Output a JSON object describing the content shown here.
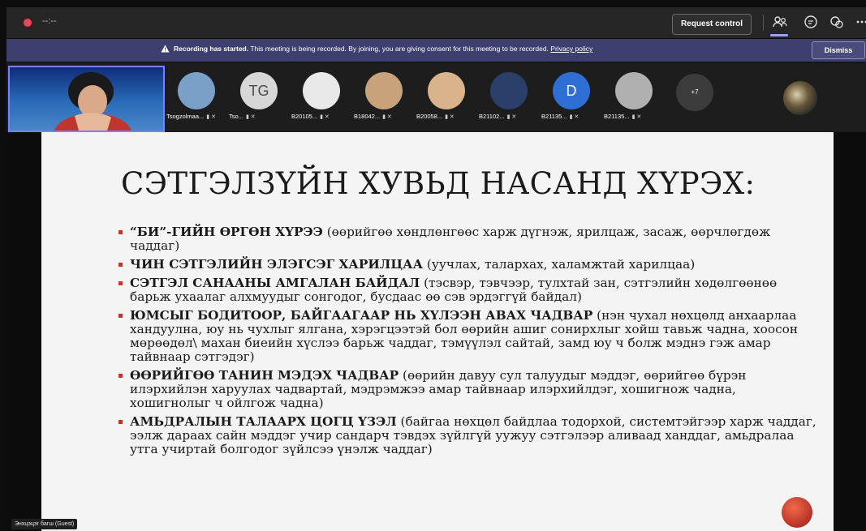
{
  "topbar": {
    "timer": "--:--",
    "request_control": "Request control",
    "icons": [
      "participants-icon",
      "chat-icon",
      "reactions-icon",
      "more-icon"
    ]
  },
  "banner": {
    "bold": "Recording has started.",
    "text": " This meeting is being recorded. By joining, you are giving consent for this meeting to be recorded. ",
    "link": "Privacy policy",
    "dismiss": "Dismiss"
  },
  "participants": [
    {
      "label": "Tsogzolmaa...",
      "initials": "",
      "color": "#7aa0c8"
    },
    {
      "label": "Tso...",
      "initials": "TG",
      "color": "#d7d7d7"
    },
    {
      "label": "B20105...",
      "initials": "",
      "color": "#e9e9e9"
    },
    {
      "label": "B18042...",
      "initials": "",
      "color": "#c8a27a"
    },
    {
      "label": "B20058...",
      "initials": "",
      "color": "#d9b38c"
    },
    {
      "label": "B21102...",
      "initials": "",
      "color": "#2a3f6a"
    },
    {
      "label": "B21135...",
      "initials": "D",
      "color": "#2e6fd6"
    },
    {
      "label": "B21135...",
      "initials": "",
      "color": "#b0b0b0"
    }
  ],
  "more_count": "+7",
  "slide": {
    "title": "СЭТГЭЛЗҮЙН ХУВЬД НАСАНД ХҮРЭХ:",
    "bullets": [
      {
        "bold": "“БИ”-ГИЙН ӨРГӨН ХҮРЭЭ",
        "text": " (өөрийгөө хөндлөнгөөс харж дүгнэж, ярилцаж, засаж, өөрчлөгдөж чаддаг)"
      },
      {
        "bold": "ЧИН СЭТГЭЛИЙН ЭЛЭГСЭГ ХАРИЛЦАА",
        "text": " (уучлах, талархах, халамжтай харилцаа)"
      },
      {
        "bold": "СЭТГЭЛ САНААНЫ АМГАЛАН БАЙДАЛ",
        "text": " (тэсвэр, тэвчээр, тулхтай зан, сэтгэлийн хөдөлгөөнөө барьж ухаалаг алхмуудыг сонгодог, бусдаас өө сэв эрдэггүй байдал)"
      },
      {
        "bold": "ЮМСЫГ БОДИТООР, БАЙГААГААР НЬ ХҮЛЭЭН АВАХ ЧАДВАР",
        "text": " (нэн чухал нөхцөлд анхаарлаа хандуулна, юу нь чухлыг ялгана, хэрэгцээтэй бол өөрийн ашиг сонирхлыг хойш тавьж чадна, хоосон мөрөөдөл\\ махан биеийн хүслээ барьж чаддаг, тэмүүлэл сайтай, замд юу ч болж мэднэ гэж амар тайвнаар сэтгэдэг)"
      },
      {
        "bold": "ӨӨРИЙГӨӨ ТАНИН МЭДЭХ ЧАДВАР",
        "text": " (өөрийн давуу сул талуудыг мэддэг, өөрийгөө бүрэн илэрхийлэн харуулах чадвартай, мэдрэмжээ амар тайвнаар илэрхийлдэг, хошигнож чадна, хошигнолыг ч ойлгож чадна)"
      },
      {
        "bold": "АМЬДРАЛЫН ТАЛААРХ ЦОГЦ ҮЗЭЛ",
        "text": " (байгаа нөхцөл байдлаа тодорхой, системтэйгээр харж чаддаг, ээлж дараах сайн мэддэг учир сандарч тэвдэх зүйлгүй уужуу сэтгэлээр аливаад ханддаг, амьдралаа утга учиртай болгодог зүйлсээ үнэлж чаддаг)"
      }
    ]
  },
  "presenter_name": "Энхцэцэг багш (Guest)"
}
